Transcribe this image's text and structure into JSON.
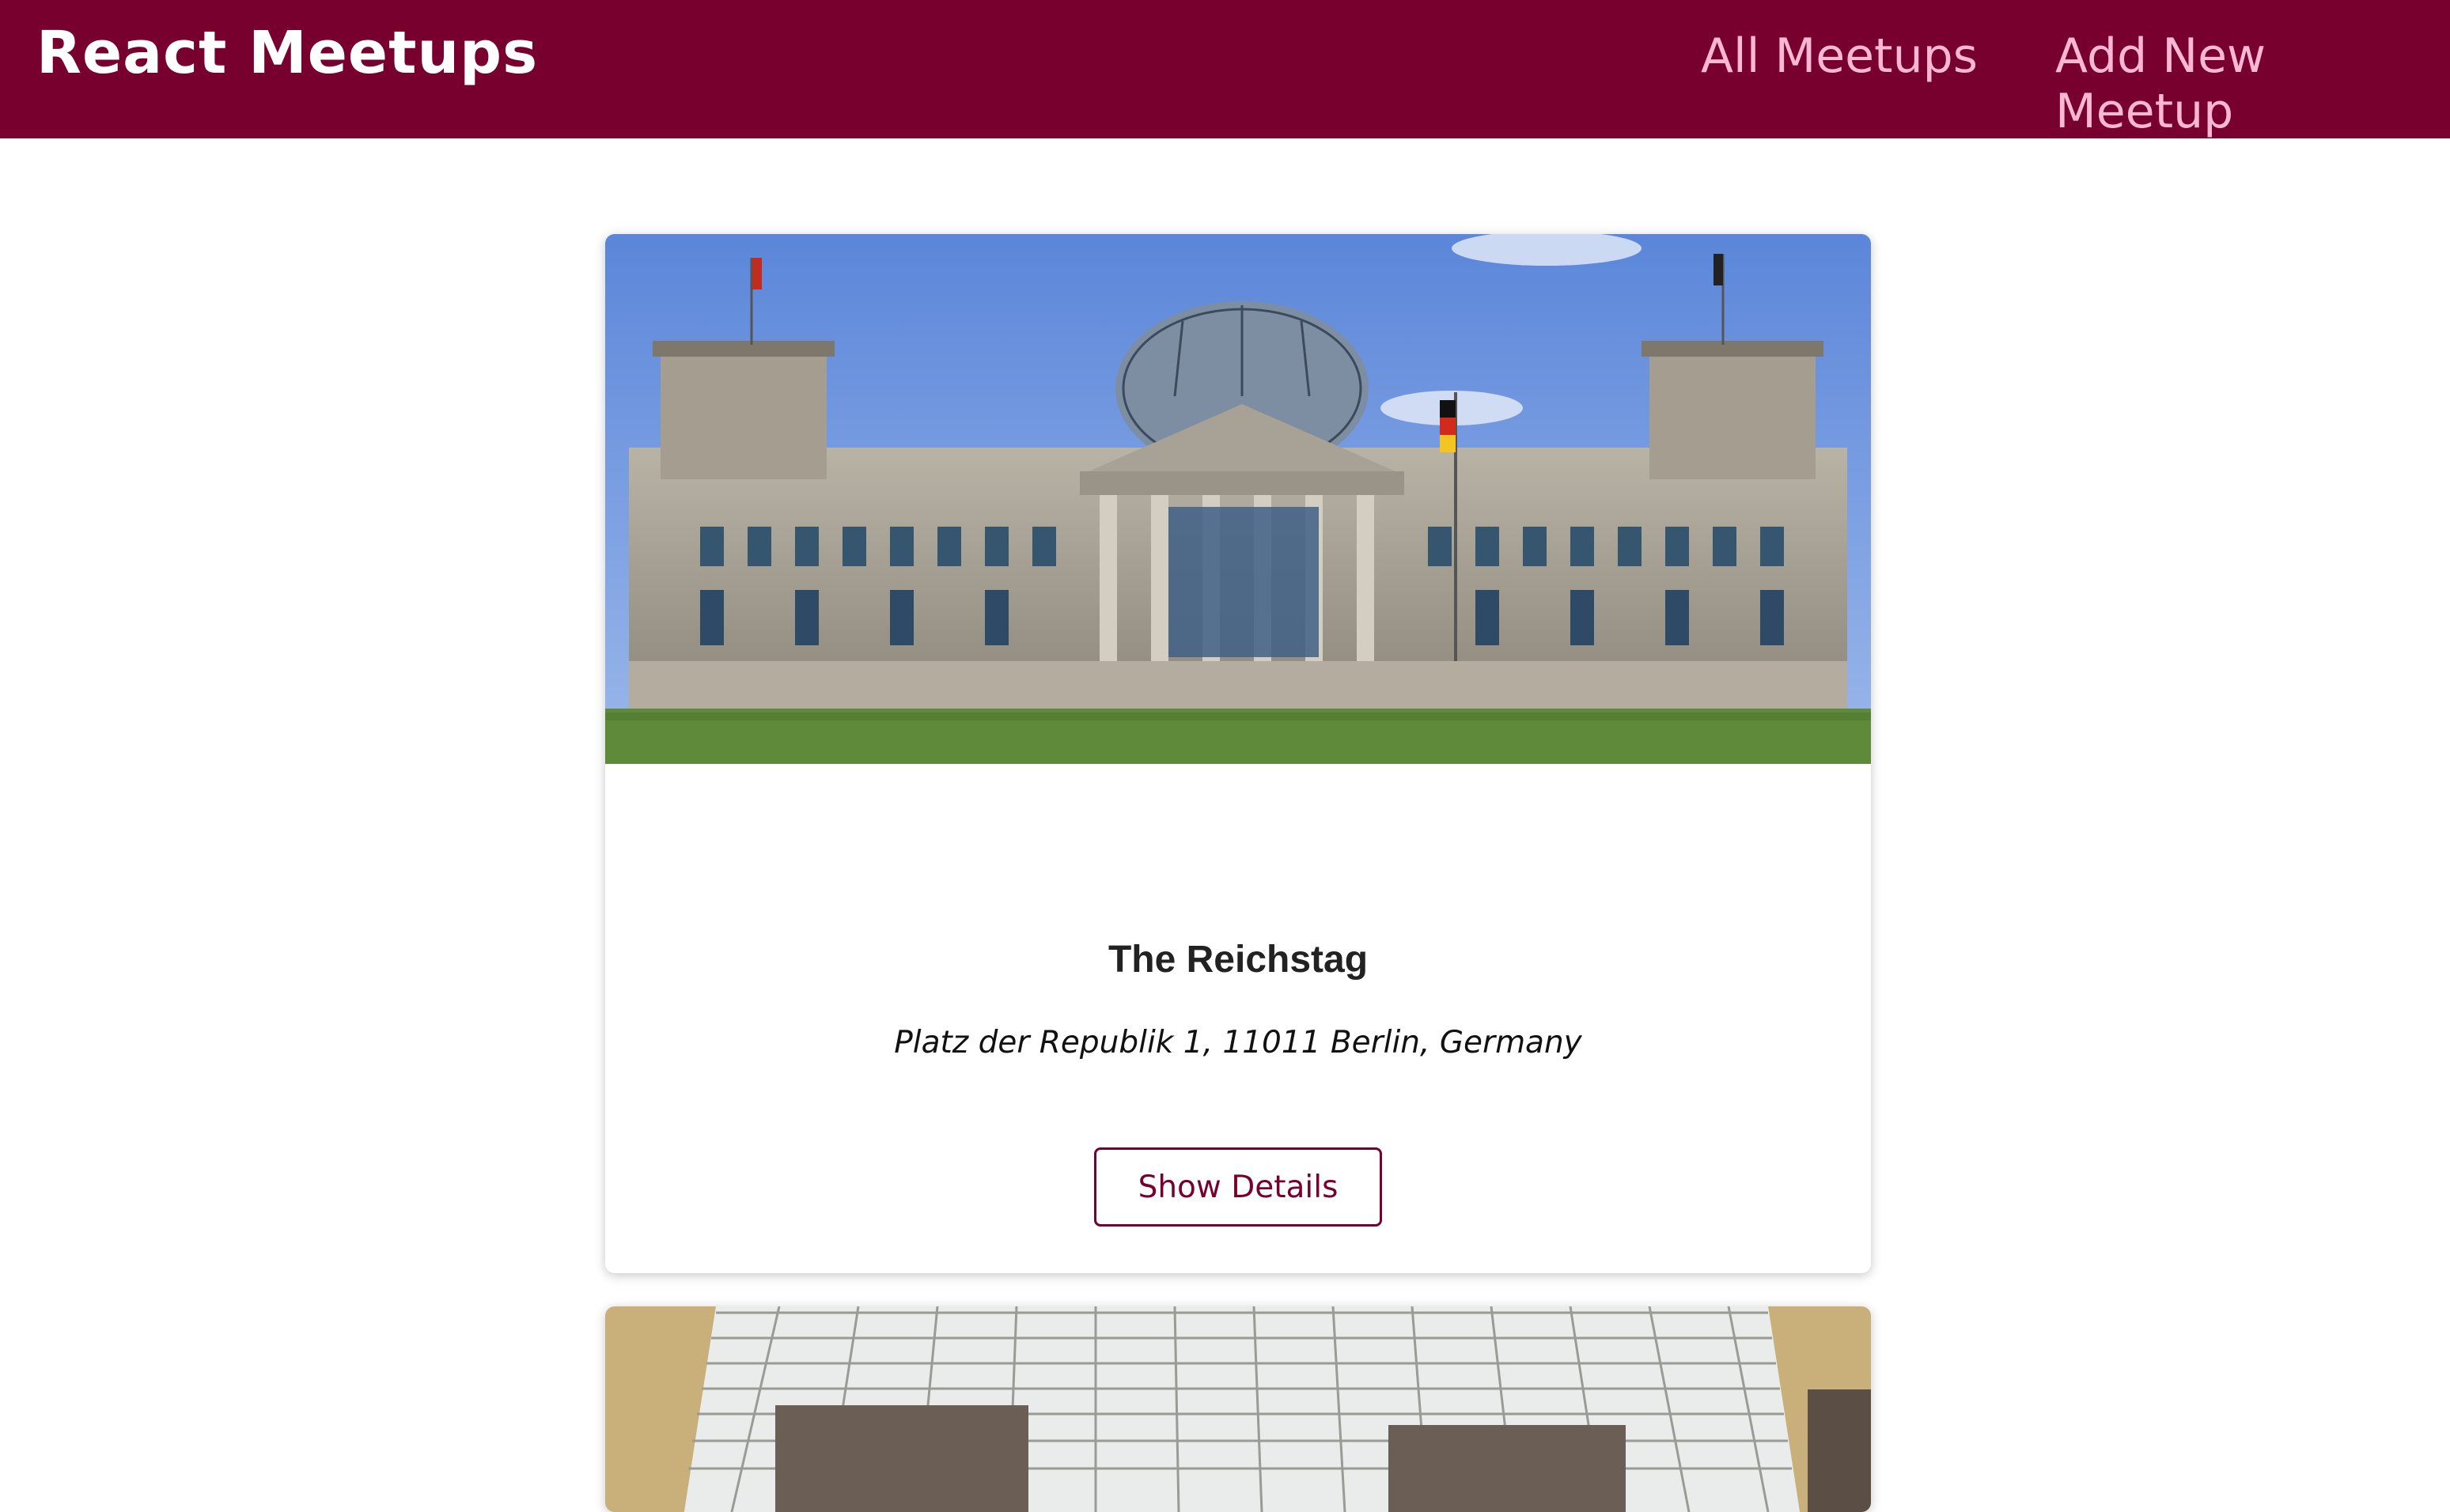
{
  "header": {
    "logo": "React Meetups",
    "nav": [
      {
        "label": "All Meetups"
      },
      {
        "label": "Add New Meetup"
      }
    ]
  },
  "meetups": [
    {
      "title": "The Reichstag",
      "address": "Platz der Republik 1, 11011 Berlin, Germany",
      "button_label": "Show Details"
    }
  ],
  "colors": {
    "header_bg": "#77002e",
    "nav_text": "#fcb8d2",
    "accent": "#77002e"
  }
}
